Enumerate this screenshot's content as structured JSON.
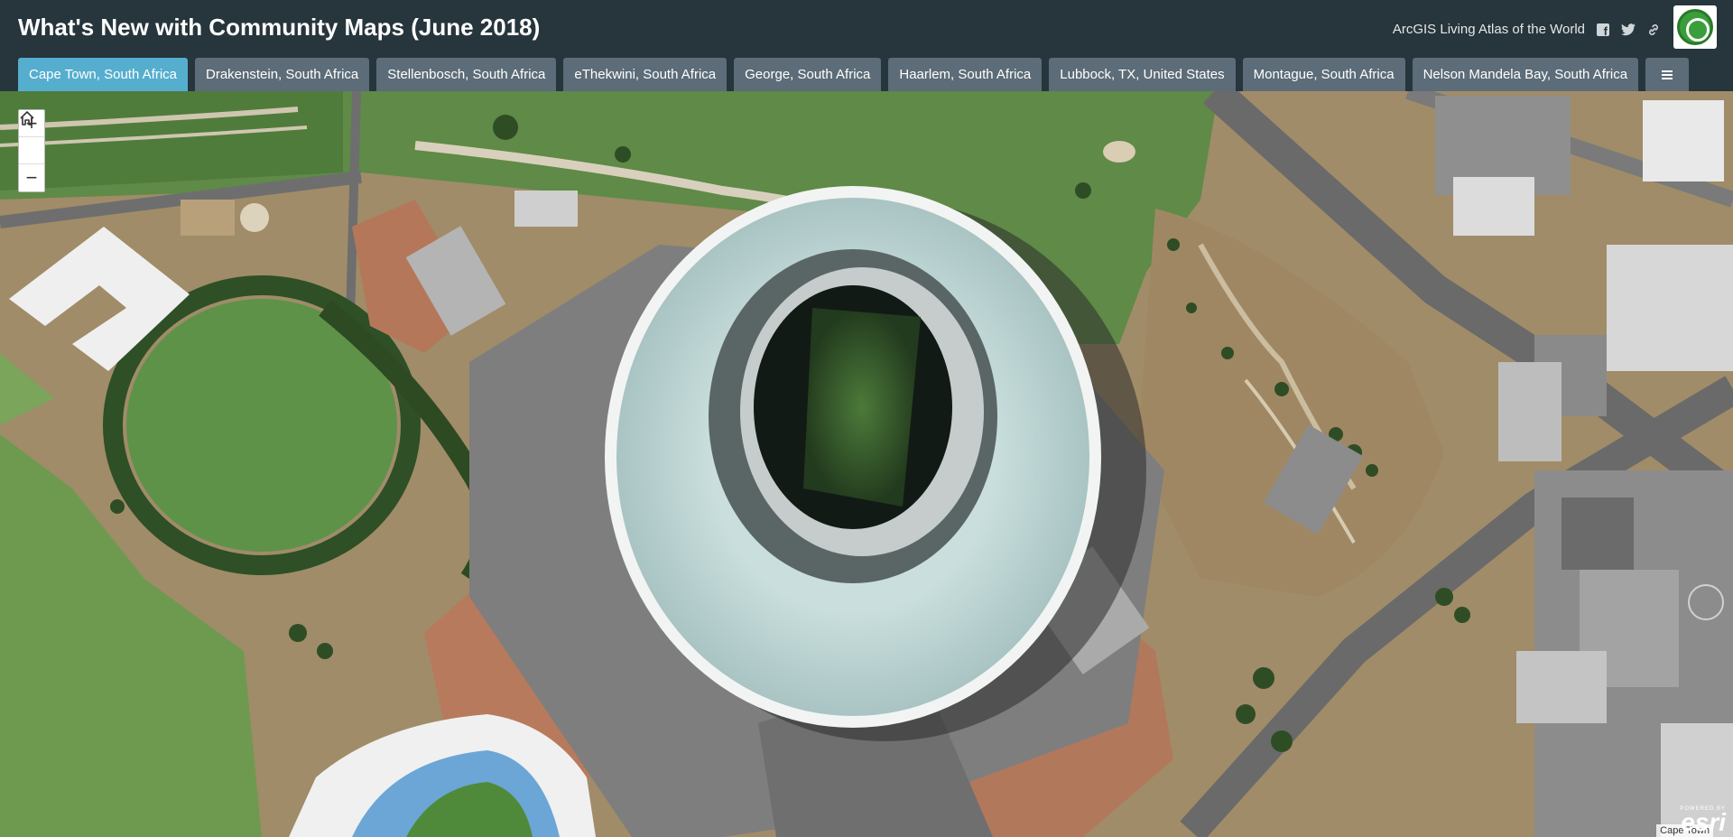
{
  "header": {
    "title": "What's New with Community Maps (June 2018)",
    "living_atlas": "ArcGIS Living Atlas of the World",
    "share_icons": [
      "facebook-icon",
      "twitter-icon",
      "link-icon"
    ],
    "bg_color": "#27353c"
  },
  "tabs": [
    {
      "label": "Cape Town, South Africa",
      "active": true
    },
    {
      "label": "Drakenstein, South Africa",
      "active": false
    },
    {
      "label": "Stellenbosch, South Africa",
      "active": false
    },
    {
      "label": "eThekwini, South Africa",
      "active": false
    },
    {
      "label": "George, South Africa",
      "active": false
    },
    {
      "label": "Haarlem, South Africa",
      "active": false
    },
    {
      "label": "Lubbock, TX, United States",
      "active": false
    },
    {
      "label": "Montague, South Africa",
      "active": false
    },
    {
      "label": "Nelson Mandela Bay, South Africa",
      "active": false
    }
  ],
  "colors": {
    "active_tab": "#56aecf",
    "inactive_tab": "#5c6c78"
  },
  "map": {
    "zoom_in": "+",
    "home": "⌂",
    "zoom_out": "−",
    "attribution": "Cape Town",
    "powered_by": "POWERED BY",
    "esri": "esri"
  }
}
